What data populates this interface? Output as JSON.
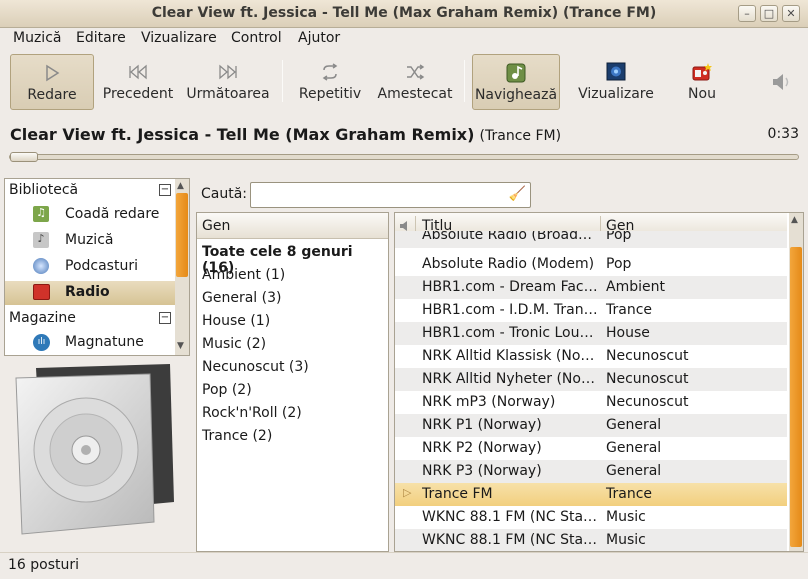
{
  "window": {
    "title": "Clear View ft. Jessica - Tell Me (Max Graham Remix) (Trance FM)",
    "min": "–",
    "max": "□",
    "close": "✕"
  },
  "menu": {
    "items": [
      {
        "label": "Muzică"
      },
      {
        "label": "Editare"
      },
      {
        "label": "Vizualizare"
      },
      {
        "label": "Control"
      },
      {
        "label": "Ajutor"
      }
    ]
  },
  "toolbar": {
    "play": "Redare",
    "previous": "Precedent",
    "next": "Următoarea",
    "repeat": "Repetitiv",
    "shuffle": "Amestecat",
    "browse": "Navighează",
    "visualize": "Vizualizare",
    "new": "Nou"
  },
  "now_playing": {
    "track": "Clear View ft. Jessica - Tell Me (Max Graham Remix)",
    "station": "(Trance FM)",
    "time": "0:33"
  },
  "sidebar": {
    "library_header": "Bibliotecă",
    "items": [
      {
        "label": "Coadă redare",
        "icon": "queue-icon"
      },
      {
        "label": "Muzică",
        "icon": "music-icon"
      },
      {
        "label": "Podcasturi",
        "icon": "podcast-icon"
      },
      {
        "label": "Radio",
        "icon": "radio-icon",
        "selected": true
      }
    ],
    "stores_header": "Magazine",
    "stores": [
      {
        "label": "Magnatune",
        "icon": "magnatune-icon"
      }
    ],
    "collapse": "−"
  },
  "search": {
    "label": "Caută:",
    "value": ""
  },
  "genres": {
    "header": "Gen",
    "items": [
      {
        "label": "Toate cele 8 genuri (16)"
      },
      {
        "label": "Ambient (1)"
      },
      {
        "label": "General (3)"
      },
      {
        "label": "House (1)"
      },
      {
        "label": "Music (2)"
      },
      {
        "label": "Necunoscut (3)"
      },
      {
        "label": "Pop (2)"
      },
      {
        "label": "Rock'n'Roll (2)"
      },
      {
        "label": "Trance (2)"
      }
    ]
  },
  "stations": {
    "col_title": "Titlu",
    "col_genre": "Gen",
    "rows": [
      {
        "title": "Absolute Radio (Broad…",
        "genre": "Pop"
      },
      {
        "title": "Absolute Radio (Modem)",
        "genre": "Pop"
      },
      {
        "title": "HBR1.com - Dream Fact…",
        "genre": "Ambient"
      },
      {
        "title": "HBR1.com - I.D.M. Tranc…",
        "genre": "Trance"
      },
      {
        "title": "HBR1.com - Tronic Lounge",
        "genre": "House"
      },
      {
        "title": "NRK Alltid Klassisk (Nor…",
        "genre": "Necunoscut"
      },
      {
        "title": "NRK Alltid Nyheter (Nor…",
        "genre": "Necunoscut"
      },
      {
        "title": "NRK mP3 (Norway)",
        "genre": "Necunoscut"
      },
      {
        "title": "NRK P1 (Norway)",
        "genre": "General"
      },
      {
        "title": "NRK P2 (Norway)",
        "genre": "General"
      },
      {
        "title": "NRK P3 (Norway)",
        "genre": "General"
      },
      {
        "title": "Trance FM",
        "genre": "Trance",
        "playing": true
      },
      {
        "title": "WKNC 88.1 FM (NC Stat…",
        "genre": "Music"
      },
      {
        "title": "WKNC 88.1 FM (NC Stat…",
        "genre": "Music"
      }
    ]
  },
  "status": {
    "text": "16 posturi"
  }
}
